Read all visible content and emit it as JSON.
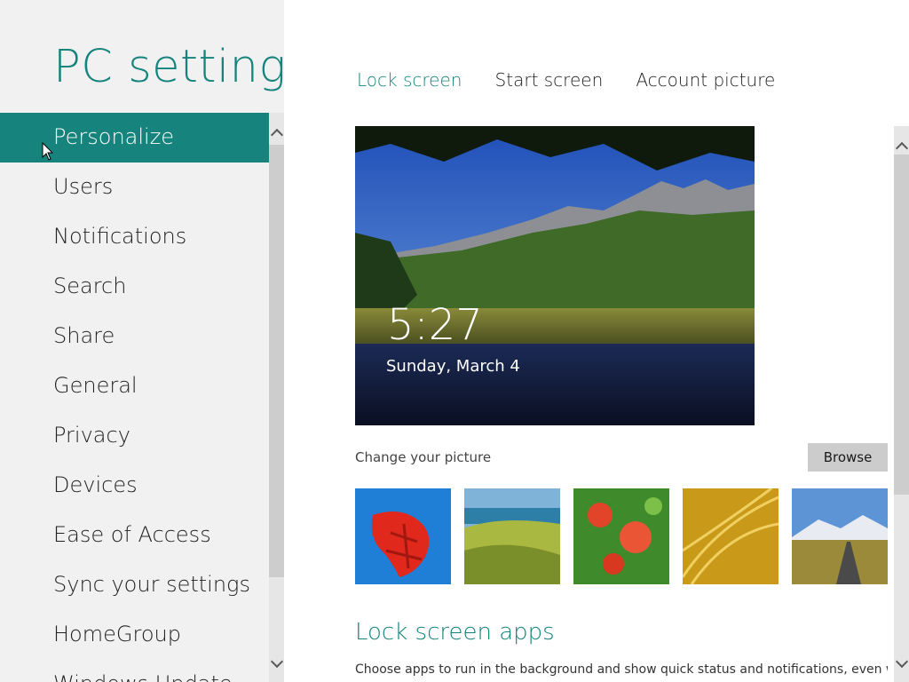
{
  "app": {
    "title": "PC settings"
  },
  "nav": {
    "items": [
      {
        "label": "Personalize",
        "selected": true
      },
      {
        "label": "Users"
      },
      {
        "label": "Notifications"
      },
      {
        "label": "Search"
      },
      {
        "label": "Share"
      },
      {
        "label": "General"
      },
      {
        "label": "Privacy"
      },
      {
        "label": "Devices"
      },
      {
        "label": "Ease of Access"
      },
      {
        "label": "Sync your settings"
      },
      {
        "label": "HomeGroup"
      },
      {
        "label": "Windows Update"
      }
    ]
  },
  "tabs": [
    {
      "label": "Lock screen",
      "active": true
    },
    {
      "label": "Start screen"
    },
    {
      "label": "Account picture"
    }
  ],
  "lock_preview": {
    "time": "5:27",
    "date": "Sunday, March 4"
  },
  "picture": {
    "change_label": "Change your picture",
    "browse_label": "Browse"
  },
  "lock_apps": {
    "heading": "Lock screen apps",
    "description": "Choose apps to run in the background and show quick status and notifications, even when"
  },
  "colors": {
    "accent": "#16837c",
    "nav_background": "#f1f1f1",
    "button": "#cccccc"
  },
  "icons": [
    "chevron-up-icon",
    "chevron-down-icon",
    "mouse-cursor-icon"
  ]
}
